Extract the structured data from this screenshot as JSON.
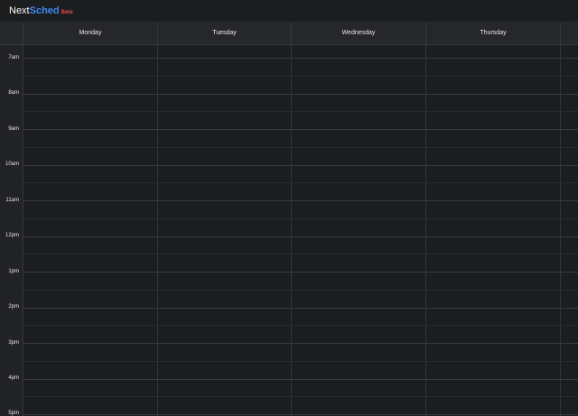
{
  "app": {
    "name_part1": "Next",
    "name_part2": "Sched",
    "badge": "Beta"
  },
  "days": [
    "Monday",
    "Tuesday",
    "Wednesday",
    "Thursday",
    ""
  ],
  "hours": [
    "7am",
    "8am",
    "9am",
    "10am",
    "11am",
    "12pm",
    "1pm",
    "2pm",
    "3pm",
    "4pm",
    "5pm"
  ],
  "colors": {
    "background": "#1a1b1d",
    "accent": "#3d8bf2",
    "badge": "#e5484d"
  }
}
